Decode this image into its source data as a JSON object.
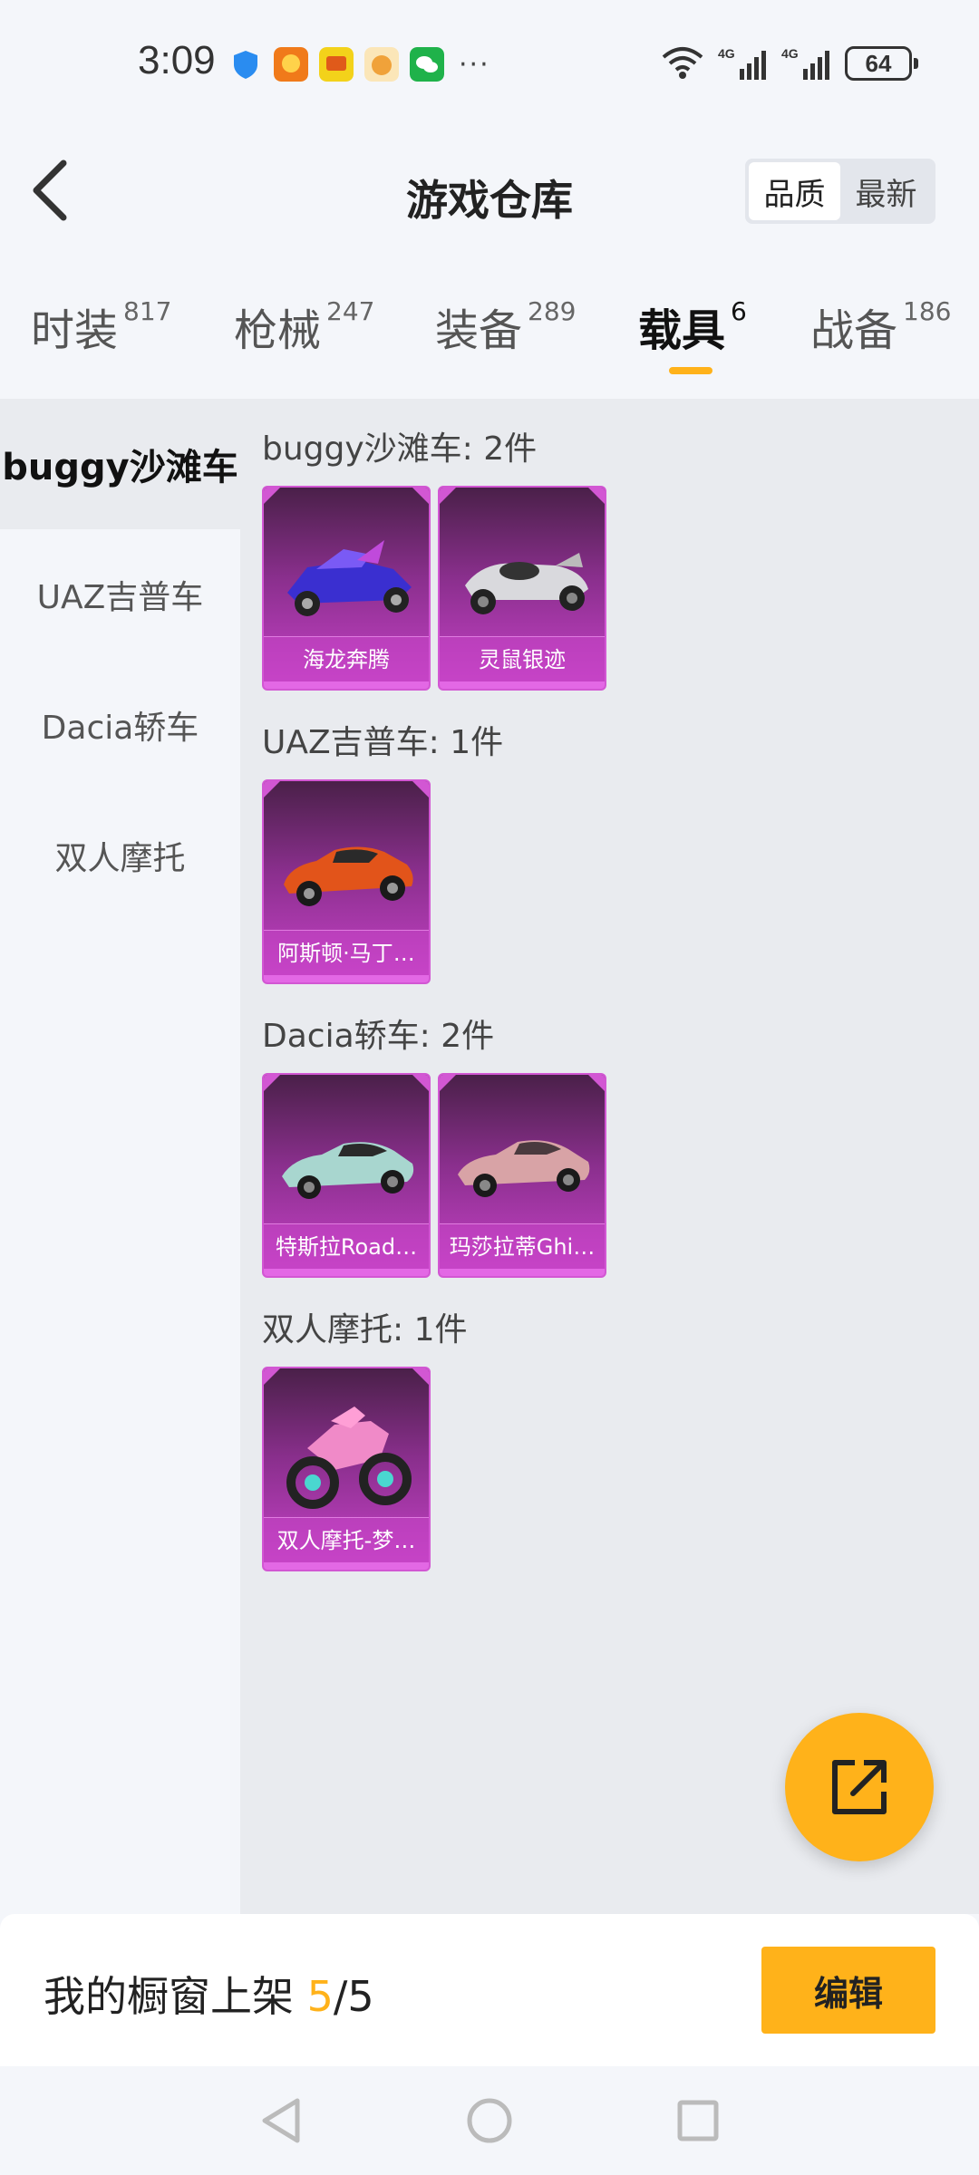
{
  "status_bar": {
    "time": "3:09",
    "more": "···",
    "battery": "64",
    "network1": "4G",
    "network2": "4G"
  },
  "header": {
    "title": "游戏仓库",
    "sort_options": [
      "品质",
      "最新"
    ],
    "sort_active": "品质"
  },
  "tabs": [
    {
      "label": "时装",
      "count": "817"
    },
    {
      "label": "枪械",
      "count": "247"
    },
    {
      "label": "装备",
      "count": "289"
    },
    {
      "label": "载具",
      "count": "6"
    },
    {
      "label": "战备",
      "count": "186"
    }
  ],
  "active_tab": "载具",
  "sidebar": {
    "items": [
      "buggy沙滩车",
      "UAZ吉普车",
      "Dacia轿车",
      "双人摩托"
    ],
    "active": "buggy沙滩车"
  },
  "sections": [
    {
      "title": "buggy沙滩车: 2件",
      "items": [
        "海龙奔腾",
        "灵鼠银迹"
      ]
    },
    {
      "title": "UAZ吉普车: 1件",
      "items": [
        "阿斯顿·马丁…"
      ]
    },
    {
      "title": "Dacia轿车: 2件",
      "items": [
        "特斯拉Road…",
        "玛莎拉蒂Ghi…"
      ]
    },
    {
      "title": "双人摩托: 1件",
      "items": [
        "双人摩托-梦…"
      ]
    }
  ],
  "colors": {
    "accent": "#ffb21a",
    "card_purple": "#c742c8"
  },
  "bottom_bar": {
    "label": "我的橱窗上架",
    "count_current": "5",
    "count_total": "/5",
    "edit_label": "编辑"
  },
  "icons": {
    "back": "chevron-left-icon",
    "fab": "share-edit-icon",
    "nav": [
      "back-triangle-icon",
      "home-circle-icon",
      "recent-square-icon"
    ]
  }
}
